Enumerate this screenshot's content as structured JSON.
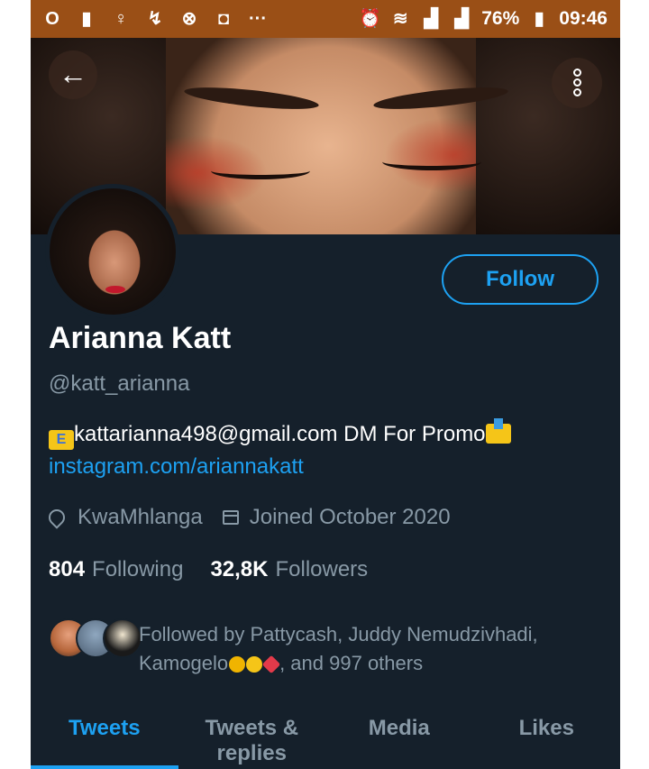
{
  "statusbar": {
    "battery": "76%",
    "time": "09:46",
    "icons": [
      "opera-icon",
      "file-icon",
      "location-icon",
      "sim-icon",
      "wifi-off-icon",
      "lock-icon",
      "more-icon",
      "alarm-icon",
      "wifi-icon",
      "signal-icon",
      "signal-icon",
      "battery-icon"
    ]
  },
  "header": {
    "back_icon": "arrow-left-icon",
    "more_icon": "more-vertical-icon"
  },
  "profile": {
    "follow_label": "Follow",
    "name": "Arianna Katt",
    "handle": "@katt_arianna",
    "bio_text": "kattarianna498@gmail.com DM For Promo",
    "link": "instagram.com/ariannakatt",
    "location": "KwaMhlanga",
    "joined": "Joined October 2020",
    "following_count": "804",
    "following_label": "Following",
    "followers_count": "32,8K",
    "followers_label": "Followers",
    "followed_by_line1": "Followed by Pattycash, Juddy Nemudzivhadi,",
    "followed_by_name": "Kamogelo",
    "followed_by_rest": ", and 997 others"
  },
  "tabs": [
    {
      "label": "Tweets",
      "active": true
    },
    {
      "label": "Tweets & replies",
      "active": false
    },
    {
      "label": "Media",
      "active": false
    },
    {
      "label": "Likes",
      "active": false
    }
  ],
  "colors": {
    "accent": "#1da1f2",
    "background": "#15202b",
    "secondary_text": "#8899a6",
    "statusbar": "#9a4f16"
  }
}
